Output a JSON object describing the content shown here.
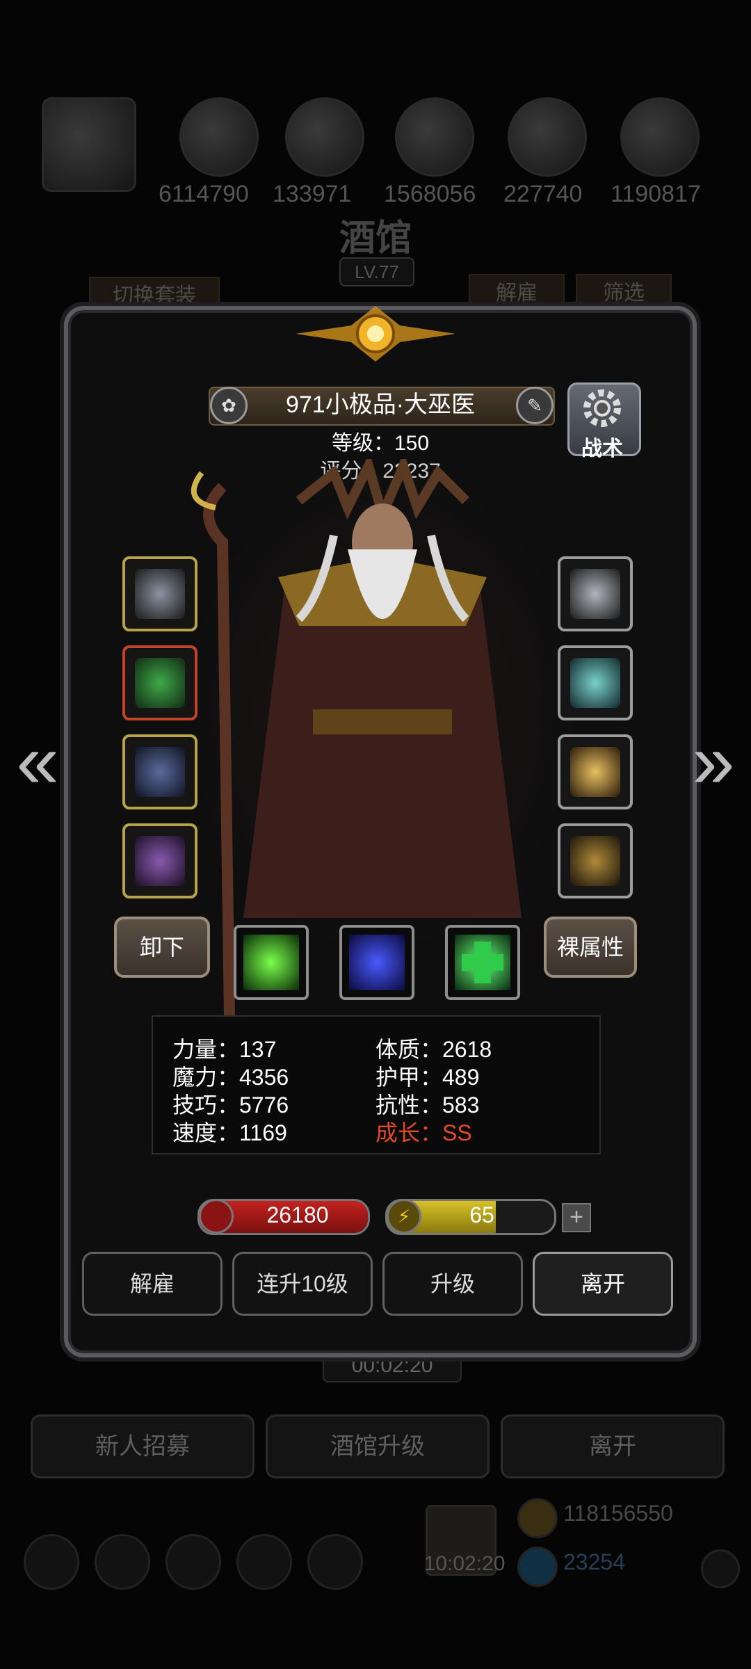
{
  "background": {
    "resources": [
      "6114790",
      "133971",
      "1568056",
      "227740",
      "1190817"
    ],
    "title": "酒馆",
    "level": "LV.77",
    "switch_outfit": "切换套装",
    "dismiss_tab": "解雇",
    "filter_tab": "筛选",
    "timer": "00:02:20",
    "buttons": [
      "新人招募",
      "酒馆升级",
      "离开"
    ],
    "gold": "118156550",
    "gems": "23254",
    "gift_timer": "10:02:20"
  },
  "hero": {
    "name": "971小极品·大巫医",
    "level_line": "等级：150",
    "score_line": "评分：23237",
    "tactic_label": "战术"
  },
  "equipment": {
    "left": [
      {
        "icon": "staff-icon",
        "color": "#6a7380"
      },
      {
        "icon": "armor-icon",
        "color": "#2f7a3a"
      },
      {
        "icon": "helmet-icon",
        "color": "#3b4a7a"
      },
      {
        "icon": "ring-icon",
        "color": "#6b3d8a"
      }
    ],
    "right": [
      {
        "icon": "bracelet-icon",
        "color": "#9aa0a8"
      },
      {
        "icon": "gem-icon",
        "color": "#4c9a96"
      },
      {
        "icon": "lantern-icon",
        "color": "#9a6a2a"
      },
      {
        "icon": "wand-icon",
        "color": "#8a6a2a"
      }
    ]
  },
  "actions": {
    "unequip": "卸下",
    "base_attr": "裸属性"
  },
  "skills": [
    {
      "icon": "green-slash-icon",
      "color": "#3fbf2a"
    },
    {
      "icon": "blue-shadow-icon",
      "color": "#2a38b0"
    },
    {
      "icon": "heal-cross-icon",
      "color": "#2ecc4a"
    }
  ],
  "stats": {
    "left": [
      "力量：137",
      "魔力：4356",
      "技巧：5776",
      "速度：1169"
    ],
    "right": [
      "体质：2618",
      "护甲：489",
      "抗性：583"
    ],
    "growth": "成长：SS"
  },
  "bars": {
    "hp": "26180",
    "hp_fill": 1.0,
    "energy": "65",
    "energy_fill": 0.65,
    "hp_color": "#c3231f",
    "energy_color": "#d6c227"
  },
  "footer": [
    "解雇",
    "连升10级",
    "升级",
    "离开"
  ]
}
